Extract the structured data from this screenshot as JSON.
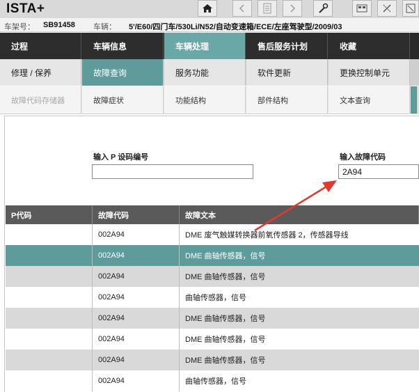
{
  "app": {
    "title": "ISTA+"
  },
  "toolbar": [
    {
      "icon": "home-icon"
    },
    {
      "icon": "back-icon"
    },
    {
      "icon": "document-icon"
    },
    {
      "icon": "forward-icon"
    },
    {
      "icon": "wrench-icon"
    },
    {
      "icon": "display-icon"
    },
    {
      "icon": "tools-icon"
    },
    {
      "icon": "window-icon"
    }
  ],
  "vehicle": {
    "vin_label": "车架号：",
    "vin": "SB91458",
    "car_label": "车辆：",
    "car": "5'/E60/四门车/530Li/N52/自动变速箱/ECE/左座驾驶型/2009/03"
  },
  "nav_main": [
    "过程",
    "车辆信息",
    "车辆处理",
    "售后服务计划",
    "收藏"
  ],
  "nav_sub": [
    "修理 / 保养",
    "故障查询",
    "服务功能",
    "软件更新",
    "更换控制单元"
  ],
  "nav_third": [
    "故障代码存储器",
    "故障症状",
    "功能结构",
    "部件结构",
    "文本查询"
  ],
  "form": {
    "p_code_label": "输入 P 设码编号",
    "p_code_value": "",
    "fault_code_label": "输入故障代码",
    "fault_code_value": "2A94"
  },
  "table": {
    "columns": [
      "P代码",
      "故障代码",
      "故障文本"
    ],
    "rows": [
      {
        "p": "",
        "code": "002A94",
        "text": "DME 废气触媒转换器前氧传感器 2，传感器导线"
      },
      {
        "p": "",
        "code": "002A94",
        "text": "DME 曲轴传感器，信号"
      },
      {
        "p": "",
        "code": "002A94",
        "text": "DME 曲轴传感器，信号"
      },
      {
        "p": "",
        "code": "002A94",
        "text": "曲轴传感器，信号"
      },
      {
        "p": "",
        "code": "002A94",
        "text": "DME 曲轴传感器，信号"
      },
      {
        "p": "",
        "code": "002A94",
        "text": "DME 曲轴传感器，信号"
      },
      {
        "p": "",
        "code": "002A94",
        "text": "DME 曲轴传感器，信号"
      },
      {
        "p": "",
        "code": "002A94",
        "text": "曲轴传感器，信号"
      }
    ]
  },
  "colors": {
    "accent": "#5e9c9c",
    "annotation": "#e8362a"
  }
}
